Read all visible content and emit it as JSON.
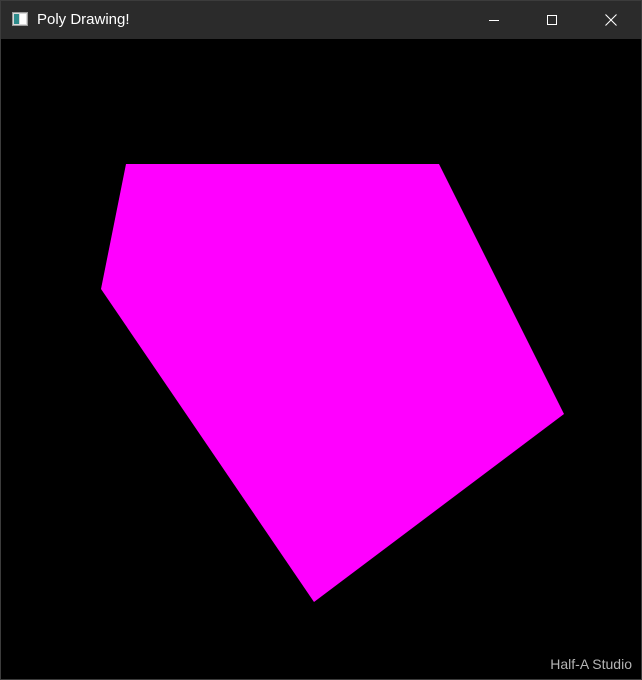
{
  "window": {
    "title": "Poly Drawing!",
    "app_icon": "app-window-icon",
    "controls": {
      "minimize_icon": "minimize-icon",
      "maximize_icon": "maximize-icon",
      "close_icon": "close-icon"
    }
  },
  "canvas": {
    "background_color": "#000000",
    "polygon": {
      "fill_color": "#ff00ff",
      "vertex_count": 5
    }
  },
  "watermark": {
    "text": "Half-A Studio"
  },
  "colors": {
    "titlebar": "#2b2b2b",
    "title_text": "#ffffff",
    "watermark": "#b4b4b4"
  }
}
